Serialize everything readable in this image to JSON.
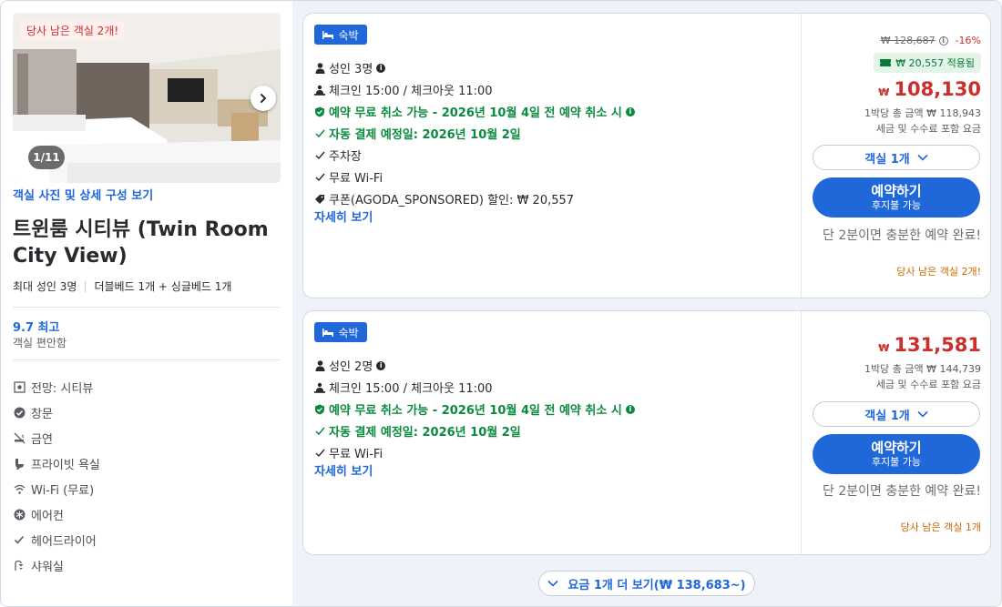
{
  "room": {
    "scarcity_tag": "당사 남은 객실 2개!",
    "photo_counter": "1/11",
    "photo_link": "객실 사진 및 상세 구성 보기",
    "title": "트윈룸 시티뷰 (Twin Room City View)",
    "max_guests": "최대 성인 3명",
    "beds": "더블베드 1개 + 싱글베드 1개",
    "score": "9.7 최고",
    "score_label": "객실 편안함",
    "amenities": [
      {
        "icon": "view-icon",
        "label": "전망: 시티뷰"
      },
      {
        "icon": "window-check-icon",
        "label": "창문"
      },
      {
        "icon": "no-smoking-icon",
        "label": "금연"
      },
      {
        "icon": "toilet-icon",
        "label": "프라이빗 욕실"
      },
      {
        "icon": "wifi-icon",
        "label": "Wi-Fi (무료)"
      },
      {
        "icon": "snowflake-icon",
        "label": "에어컨"
      },
      {
        "icon": "check-icon",
        "label": "헤어드라이어"
      },
      {
        "icon": "shower-icon",
        "label": "샤워실"
      }
    ]
  },
  "offers": [
    {
      "badge": "숙박",
      "guests": "성인 3명",
      "checkin": "체크인 15:00 / 체크아웃 11:00",
      "cancel": "예약 무료 취소 가능 - 2026년 10월 4일 전 예약 취소 시",
      "payment": "자동 결제 예정일: 2026년 10월 2일",
      "extras": [
        "주차장",
        "무료 Wi-Fi"
      ],
      "coupon": "쿠폰(AGODA_SPONSORED) 할인: ₩ 20,557",
      "more": "자세히 보기",
      "old_price": "₩ 128,687",
      "discount_pct": "-16%",
      "coupon_applied": "₩ 20,557 적용됨",
      "currency": "₩",
      "price": "108,130",
      "total_note": "1박당 총 금액 ₩ 118,943",
      "tax_note": "세금 및 수수료 포함 요금",
      "rooms_select": "객실 1개",
      "book_label": "예약하기",
      "book_sub": "후지불 가능",
      "quick_note": "단 2분이면 충분한 예약 완료!",
      "rooms_left": "당사 남은 객실 2개!"
    },
    {
      "badge": "숙박",
      "guests": "성인 2명",
      "checkin": "체크인 15:00 / 체크아웃 11:00",
      "cancel": "예약 무료 취소 가능 - 2026년 10월 4일 전 예약 취소 시",
      "payment": "자동 결제 예정일: 2026년 10월 2일",
      "extras": [
        "무료 Wi-Fi"
      ],
      "more": "자세히 보기",
      "currency": "₩",
      "price": "131,581",
      "total_note": "1박당 총 금액 ₩ 144,739",
      "tax_note": "세금 및 수수료 포함 요금",
      "rooms_select": "객실 1개",
      "book_label": "예약하기",
      "book_sub": "후지불 가능",
      "quick_note": "단 2분이면 충분한 예약 완료!",
      "rooms_left": "당사 남은 객실 1개"
    }
  ],
  "show_more": "요금 1개 더 보기(₩ 138,683~)",
  "colors": {
    "brand_blue": "#2067da",
    "price_red": "#c9302c",
    "success_green": "#0a8a3e",
    "warning_orange": "#c96a00"
  }
}
